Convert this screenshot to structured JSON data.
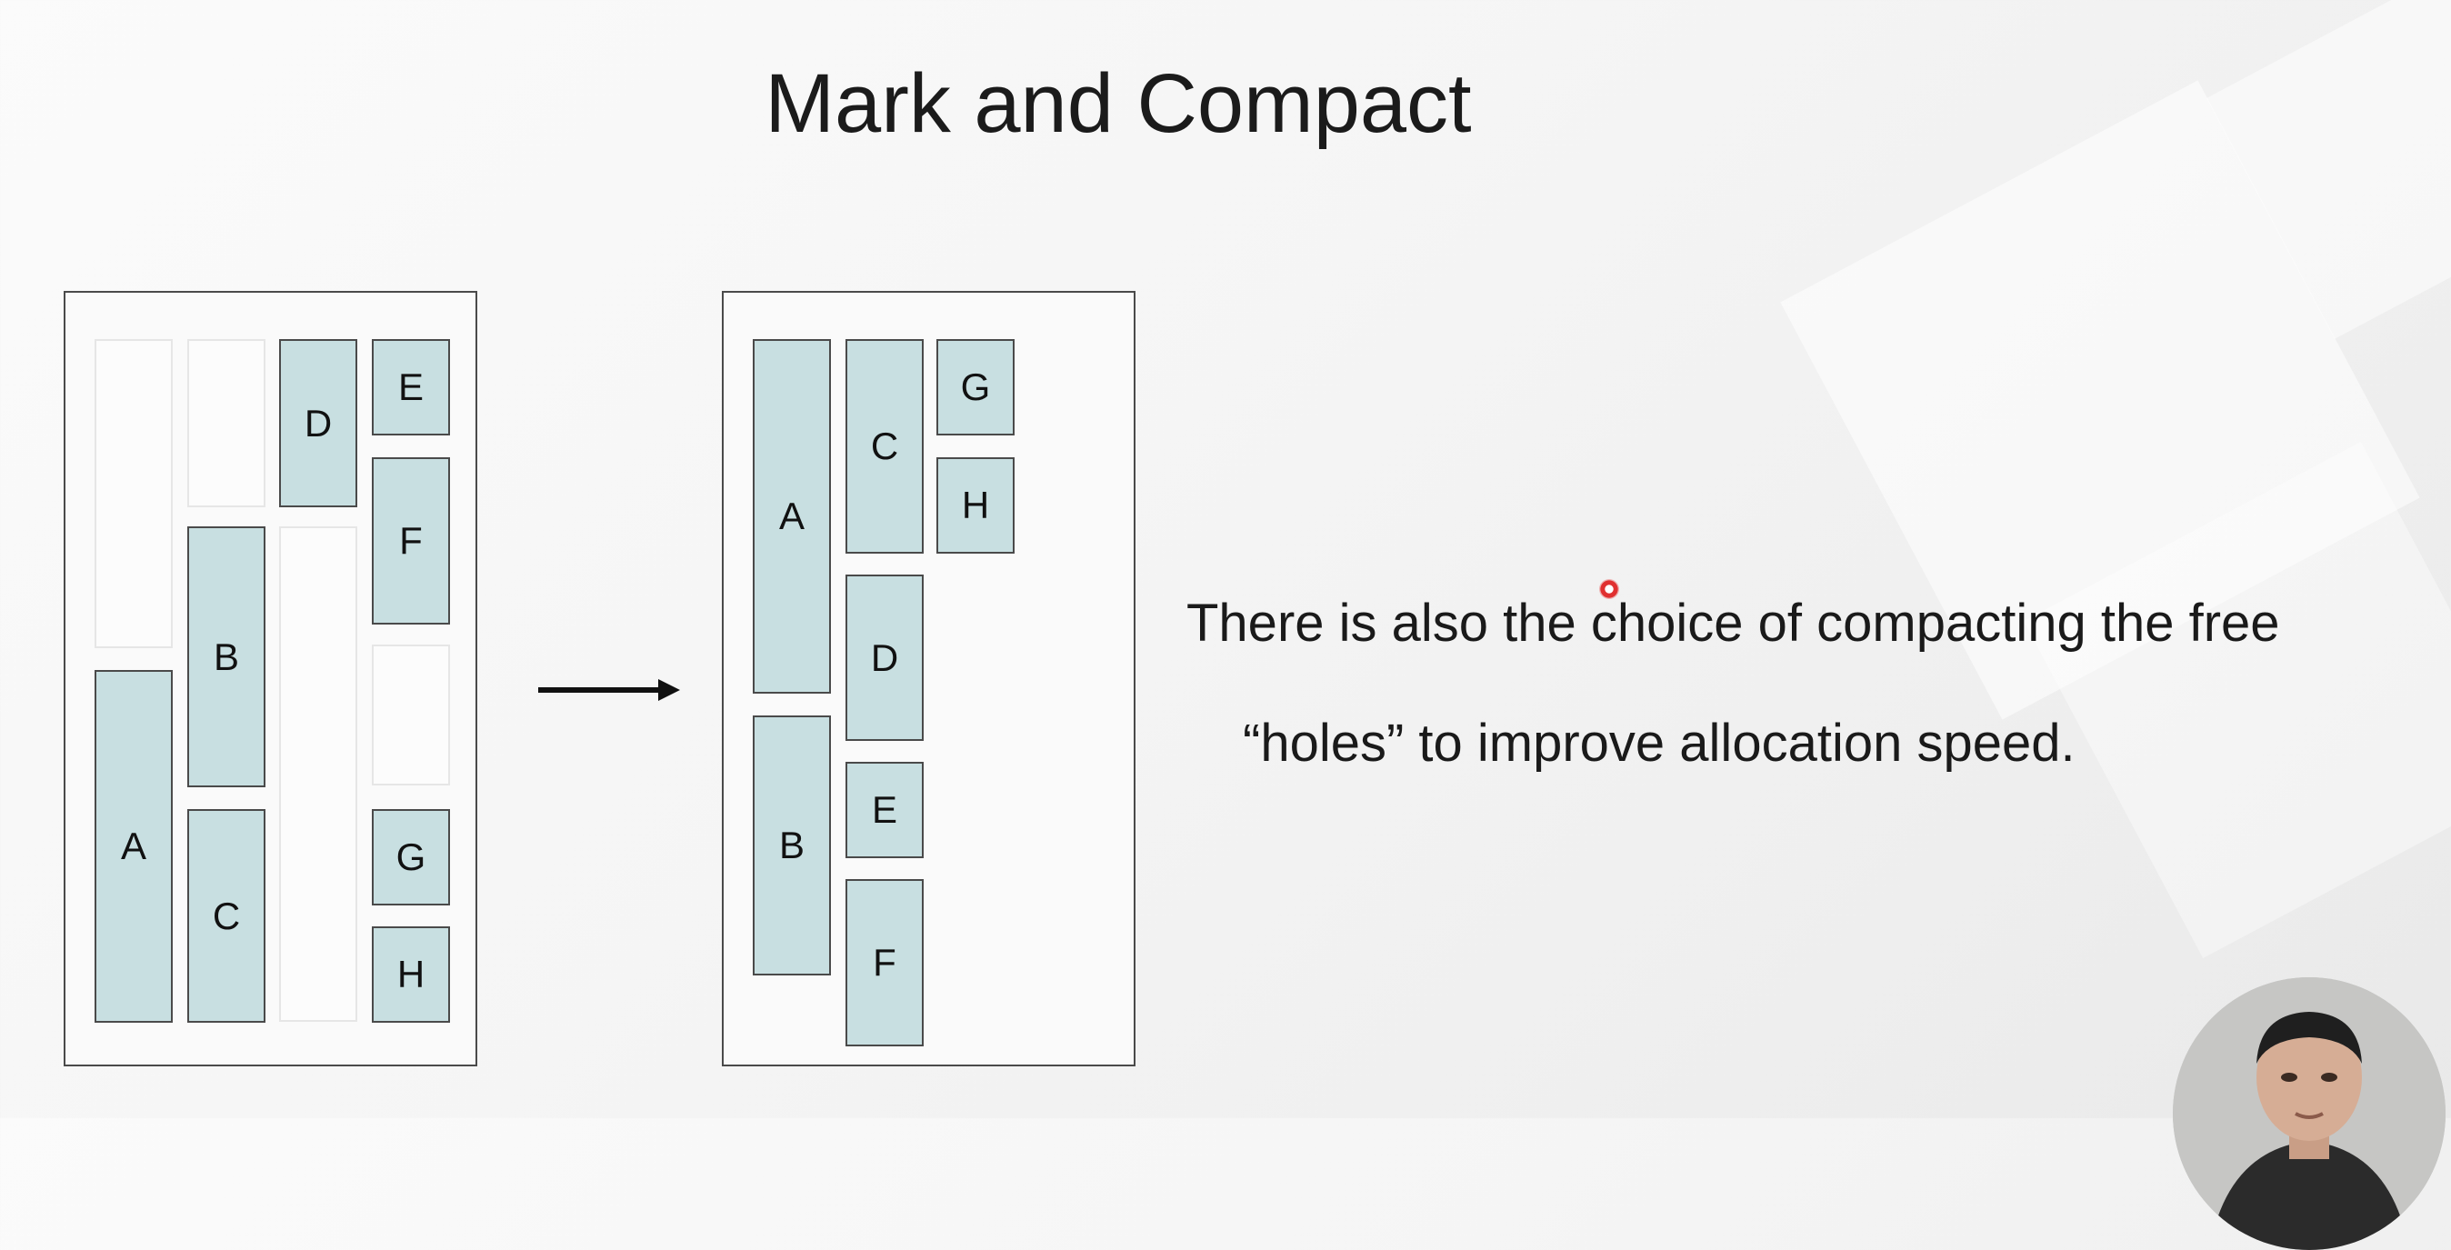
{
  "slide": {
    "title": "Mark and Compact"
  },
  "caption": {
    "line1": "There is also the choice of compacting the free",
    "line2": "“holes” to improve allocation speed."
  },
  "colors": {
    "block_fill": "#c8dfe1",
    "block_border": "#4a4a4a",
    "hole_border": "#e6e6e6"
  },
  "diagram": {
    "before": {
      "blocks": {
        "A": "A",
        "B": "B",
        "C": "C",
        "D": "D",
        "E": "E",
        "F": "F",
        "G": "G",
        "H": "H"
      }
    },
    "after": {
      "blocks": {
        "A": "A",
        "B": "B",
        "C": "C",
        "D": "D",
        "E": "E",
        "F": "F",
        "G": "G",
        "H": "H"
      }
    },
    "arrow_icon": "right-arrow-icon"
  }
}
